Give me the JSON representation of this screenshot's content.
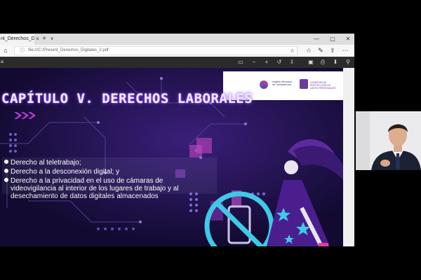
{
  "browser": {
    "tab_title": "nt_Derechos_Digit",
    "tab_close_icon": "×",
    "new_tab_icon": "+",
    "tab_list_icon": "∨",
    "window_controls": [
      "—",
      "▢",
      "✕"
    ],
    "address_url": "file:///C:/Present_Derechos_Digitales_2.pdf"
  },
  "slide": {
    "title": "CAPÍTULO V. DERECHOS LABORALES",
    "logo_left_text": "Instituto Mexicano de Transparencia",
    "logo_right_text": "COMISIÓN DE PROTECCIÓN DE DATOS PERSONALES",
    "bullets": [
      {
        "line1": "Derecho al teletrabajo;"
      },
      {
        "line1": "Derecho a la desconexión digital; y"
      },
      {
        "line1": "Derecho a la privacidad en el uso de cámaras de",
        "line2": "videovigilancia al interior de los lugares de trabajo y al",
        "line3": "desechamiento de datos digitales almacenados"
      }
    ],
    "colors": {
      "background": "#140c35",
      "accent_cyan": "#3fc9e6",
      "accent_pink": "#e43aa8",
      "accent_purple": "#7d3cff"
    }
  }
}
